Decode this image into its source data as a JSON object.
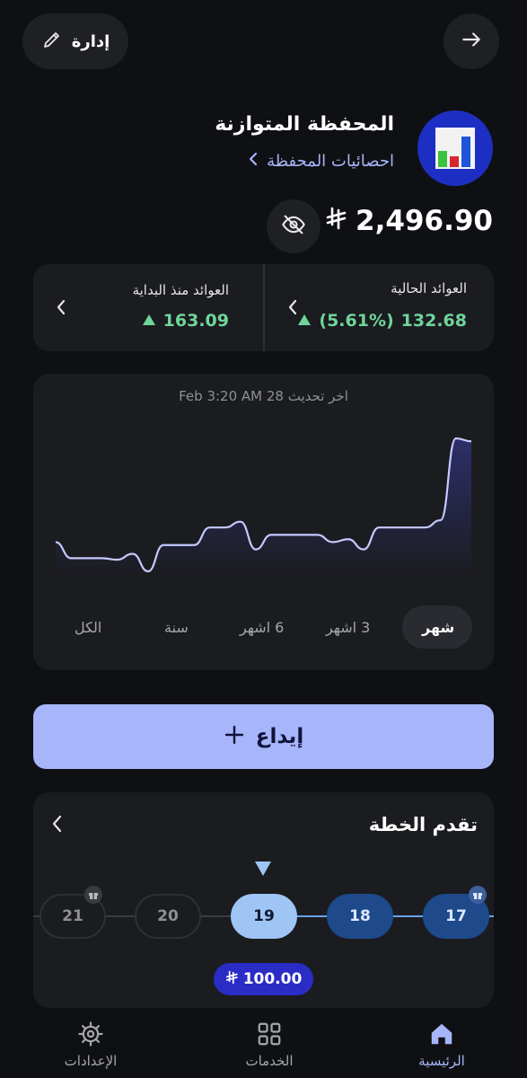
{
  "header": {
    "manage_label": "إدارة",
    "manage_icon": "pencil-icon",
    "forward_icon": "arrow-right-icon"
  },
  "portfolio": {
    "name": "المحفظة المتوازنة",
    "stats_link": "احصائيات المحفظة",
    "balance": "2,496.90",
    "currency_symbol": "⃁"
  },
  "returns": {
    "current_label": "العوائد الحالية",
    "current_value": "132.68",
    "current_percent": "(5.61%)",
    "since_start_label": "العوائد منذ البداية",
    "since_start_value": "163.09"
  },
  "chart": {
    "last_updated": "اخر تحديث 28 Feb 3:20 AM",
    "tabs": [
      "شهر",
      "3 اشهر",
      "6 اشهر",
      "سنة",
      "الكل"
    ],
    "active_tab": 0
  },
  "chart_data": {
    "type": "area",
    "title": "",
    "values": [
      2460,
      2449,
      2449,
      2449,
      2448,
      2452,
      2440,
      2458,
      2458,
      2458,
      2470,
      2470,
      2474,
      2455,
      2465,
      2465,
      2465,
      2465,
      2460,
      2462,
      2455,
      2470,
      2470,
      2470,
      2470,
      2475,
      2531,
      2529
    ],
    "colors": {
      "line": "#c6c9ff",
      "fill_top": "#2d2f6a",
      "fill_bottom": "#1b1c20"
    }
  },
  "deposit": {
    "label": "إيداع"
  },
  "plan": {
    "title": "تقدم الخطة",
    "nodes": [
      "17",
      "18",
      "19",
      "20",
      "21"
    ],
    "current": "19",
    "amount": "100.00"
  },
  "nav": {
    "home": "الرئيسية",
    "services": "الخدمات",
    "settings": "الإعدادات"
  },
  "colors": {
    "accent": "#a7b6fb",
    "done_node": "#1e4a8c",
    "current_node": "#9fc5f5",
    "amount_badge": "#2a2cc5"
  }
}
